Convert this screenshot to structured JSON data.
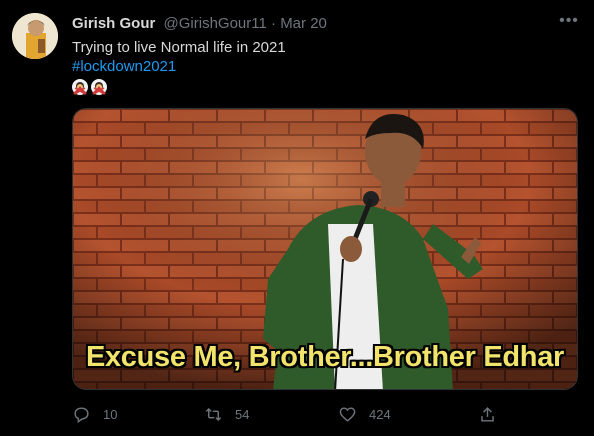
{
  "tweet": {
    "author_name": "Girish Gour",
    "author_handle": "@GirishGour11",
    "separator": "·",
    "date": "Mar 20",
    "text": "Trying to live Normal life in 2021",
    "hashtag": "#lockdown2021",
    "emojis": [
      "man-gesturing-no-emoji",
      "man-gesturing-no-emoji"
    ],
    "media": {
      "caption": "Excuse Me, Brother...Brother Edhar",
      "description_colors": {
        "wall": "#b5532f",
        "shirt": "#2f5a2a"
      }
    },
    "actions": {
      "reply_count": "10",
      "retweet_count": "54",
      "like_count": "424"
    }
  },
  "colors": {
    "background": "#000000",
    "text": "#d9d9d9",
    "muted": "#6e767d",
    "link": "#1d9bf0",
    "caption": "#f2e36b"
  }
}
